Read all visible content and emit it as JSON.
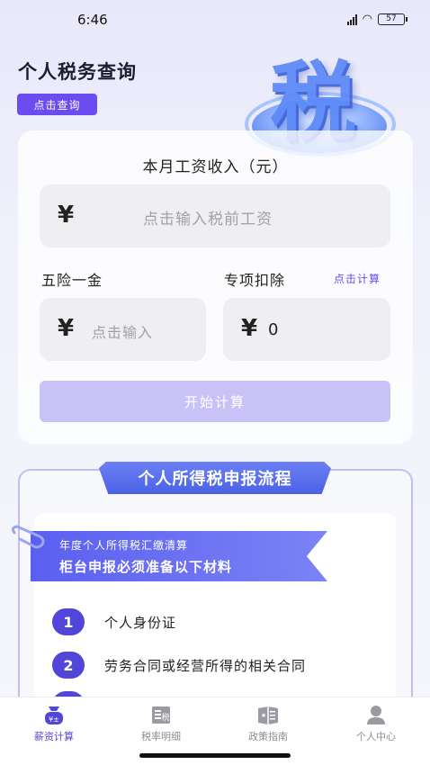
{
  "status_bar": {
    "time": "6:46",
    "battery": "57"
  },
  "header": {
    "title": "个人税务查询",
    "query_button": "点击查询"
  },
  "hero": {
    "char": "税"
  },
  "calculator": {
    "title": "本月工资收入（元）",
    "currency": "¥",
    "salary_placeholder": "点击输入税前工资",
    "insurance_label": "五险一金",
    "insurance_placeholder": "点击输入",
    "deduction_label": "专项扣除",
    "deduction_link": "点击计算",
    "deduction_value": "0",
    "start_button": "开始计算"
  },
  "flow": {
    "title": "个人所得税申报流程",
    "ribbon_line1": "年度个人所得税汇缴清算",
    "ribbon_line2": "柜台申报必须准备以下材料",
    "steps": [
      {
        "num": "1",
        "text": "个人身份证"
      },
      {
        "num": "2",
        "text": "劳务合同或经营所得的相关合同"
      }
    ]
  },
  "tabbar": {
    "items": [
      {
        "label": "薪资计算",
        "icon": "salary-calc-icon",
        "active": true
      },
      {
        "label": "税率明细",
        "icon": "tax-rate-icon",
        "active": false
      },
      {
        "label": "政策指南",
        "icon": "policy-book-icon",
        "active": false
      },
      {
        "label": "个人中心",
        "icon": "person-icon",
        "active": false
      }
    ]
  },
  "colors": {
    "accent": "#6a4cf0",
    "button_disabled": "#c9c2f7",
    "step_badge": "#5246d8"
  }
}
